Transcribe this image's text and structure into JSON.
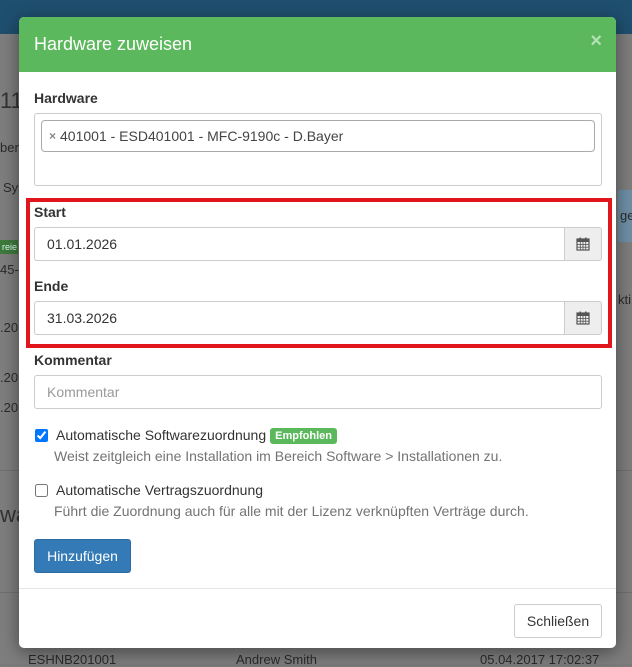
{
  "background": {
    "fragments": [
      "11",
      "ben",
      "Sys",
      "45-",
      ".20",
      "ge",
      ".20",
      "kti",
      ".20",
      "wa",
      "ESHNB201001",
      "Andrew Smith",
      "05.04.2017 17:02:37"
    ],
    "badge": "reie"
  },
  "modal": {
    "title": "Hardware zuweisen",
    "close_symbol": "×",
    "hardware_label": "Hardware",
    "hardware_tag": "401001 - ESD401001 - MFC-9190c - D.Bayer",
    "hardware_tag_remove": "×",
    "start_label": "Start",
    "start_value": "01.01.2026",
    "end_label": "Ende",
    "end_value": "31.03.2026",
    "comment_label": "Kommentar",
    "comment_placeholder": "Kommentar",
    "auto_software": {
      "label": "Automatische Softwarezuordnung",
      "badge": "Empfohlen",
      "help": "Weist zeitgleich eine Installation im Bereich Software > Installationen zu.",
      "checked": true
    },
    "auto_contract": {
      "label": "Automatische Vertragszuordnung",
      "help": "Führt die Zuordnung auch für alle mit der Lizenz verknüpften Verträge durch.",
      "checked": false
    },
    "add_button": "Hinzufügen",
    "close_button": "Schließen"
  },
  "colors": {
    "header_green": "#5cb85c",
    "primary_blue": "#337ab7",
    "highlight_red": "#e0161c"
  },
  "icons": [
    "calendar-icon",
    "close-icon"
  ]
}
